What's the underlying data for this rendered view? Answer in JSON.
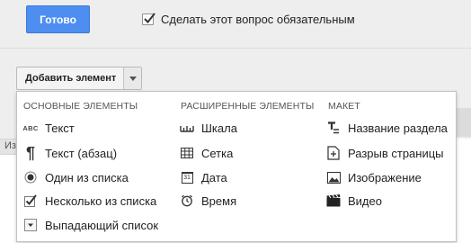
{
  "toolbar": {
    "done_label": "Готово",
    "required_label": "Сделать этот вопрос обязательным",
    "required_checked": true
  },
  "add_element": {
    "label": "Добавить элемент"
  },
  "partial_text": "Из",
  "menu": {
    "columns": [
      {
        "header": "ОСНОВНЫЕ ЭЛЕМЕНТЫ",
        "items": [
          {
            "icon": "text-icon",
            "glyph": "ABC",
            "label": "Текст"
          },
          {
            "icon": "paragraph-icon",
            "glyph": "¶",
            "label": "Текст (абзац)"
          },
          {
            "icon": "radio-icon",
            "label": "Один из списка"
          },
          {
            "icon": "checkbox-icon",
            "label": "Несколько из списка"
          },
          {
            "icon": "dropdown-icon",
            "label": "Выпадающий список"
          }
        ]
      },
      {
        "header": "РАСШИРЕННЫЕ ЭЛЕМЕНТЫ",
        "items": [
          {
            "icon": "scale-icon",
            "label": "Шкала"
          },
          {
            "icon": "grid-icon",
            "label": "Сетка"
          },
          {
            "icon": "calendar-icon",
            "glyph": "31",
            "label": "Дата"
          },
          {
            "icon": "clock-icon",
            "label": "Время"
          }
        ]
      },
      {
        "header": "МАКЕТ",
        "items": [
          {
            "icon": "section-title-icon",
            "label": "Название раздела"
          },
          {
            "icon": "page-break-icon",
            "label": "Разрыв страницы"
          },
          {
            "icon": "image-icon",
            "label": "Изображение"
          },
          {
            "icon": "video-icon",
            "label": "Видео"
          }
        ]
      }
    ]
  }
}
